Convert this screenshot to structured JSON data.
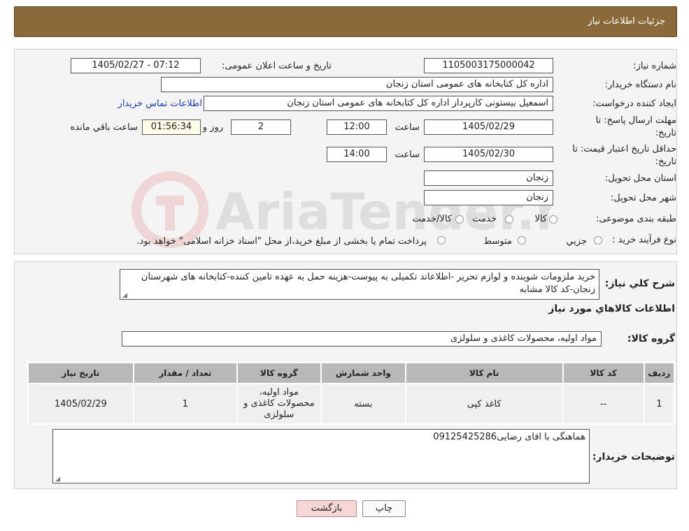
{
  "header": {
    "title": "جزئیات اطلاعات نیاز"
  },
  "form": {
    "need_number_label": "شماره نیاز:",
    "need_number": "1105003175000042",
    "announce_label": "تاریخ و ساعت اعلان عمومی:",
    "announce_value": "1405/02/27 - 07:12",
    "buyer_org_label": "نام دستگاه خریدار:",
    "buyer_org": "اداره کل کتابخانه های عمومی استان زنجان",
    "requester_label": "ایجاد کننده درخواست:",
    "requester": "اسمعیل بیستونی کارپرداز اداره کل کتابخانه های عمومی استان زنجان",
    "contact_link": "اطلاعات تماس خریدار",
    "reply_deadline_label_1": "مهلت ارسال پاسخ: تا",
    "reply_deadline_label_2": "تاریخ:",
    "reply_date": "1405/02/29",
    "time_label": "ساعت",
    "reply_time": "12:00",
    "days_value": "2",
    "days_label": "روز و",
    "remaining_time": "01:56:34",
    "remaining_label": "ساعت باقي مانده",
    "validity_label_1": "حداقل تاریخ اعتبار قیمت: تا",
    "validity_label_2": "تاریخ:",
    "validity_date": "1405/02/30",
    "validity_time": "14:00",
    "province_label": "استان محل تحویل:",
    "province": "زنجان",
    "city_label": "شهر محل تحویل:",
    "city": "زنجان",
    "category_label": "طبقه بندی موضوعی:",
    "category_options": [
      "کالا",
      "خدمت",
      "کالا/خدمت"
    ],
    "process_label": "نوع فرآیند خرید :",
    "process_options": [
      "جزیي",
      "متوسط"
    ],
    "process_note": "پرداخت تمام یا بخشی از مبلغ خرید،از محل \"اسناد خزانه اسلامی\" خواهد بود."
  },
  "description": {
    "label": "شرح کلي نياز:",
    "text": "خرید ملزومات شوینده و لوازم تحریر -اطلاعاتد تکمیلی به پیوست-هزینه حمل به عهده تامین کننده-کتابخانه های شهرستان زنجان-کد کالا مشابه",
    "goods_title": "اطلاعات کالاهاي مورد نياز",
    "group_label": "گروه کالا:",
    "group_value": "مواد اولیه، محصولات کاغذی و سلولزی"
  },
  "table": {
    "headers": [
      "رديف",
      "کد کالا",
      "نام کالا",
      "واحد شمارش",
      "گروه کالا",
      "تعداد / مقدار",
      "تاريخ نياز"
    ],
    "rows": [
      [
        "1",
        "--",
        "کاغذ کپی",
        "بسته",
        "مواد اولیه، محصولات کاغذی و سلولزی",
        "1",
        "1405/02/29"
      ]
    ]
  },
  "buyer_notes": {
    "label": "توضیحات خریدار:",
    "text": "هماهنگی با اقای رضایی09125425286"
  },
  "buttons": {
    "print": "چاپ",
    "back": "بازگشت"
  },
  "watermark_text": "AriaTender.neT",
  "colors": {
    "header_bg": "#8a6a3b",
    "link": "#1a3fb0",
    "back_button_bg": "#f6d6d6"
  }
}
